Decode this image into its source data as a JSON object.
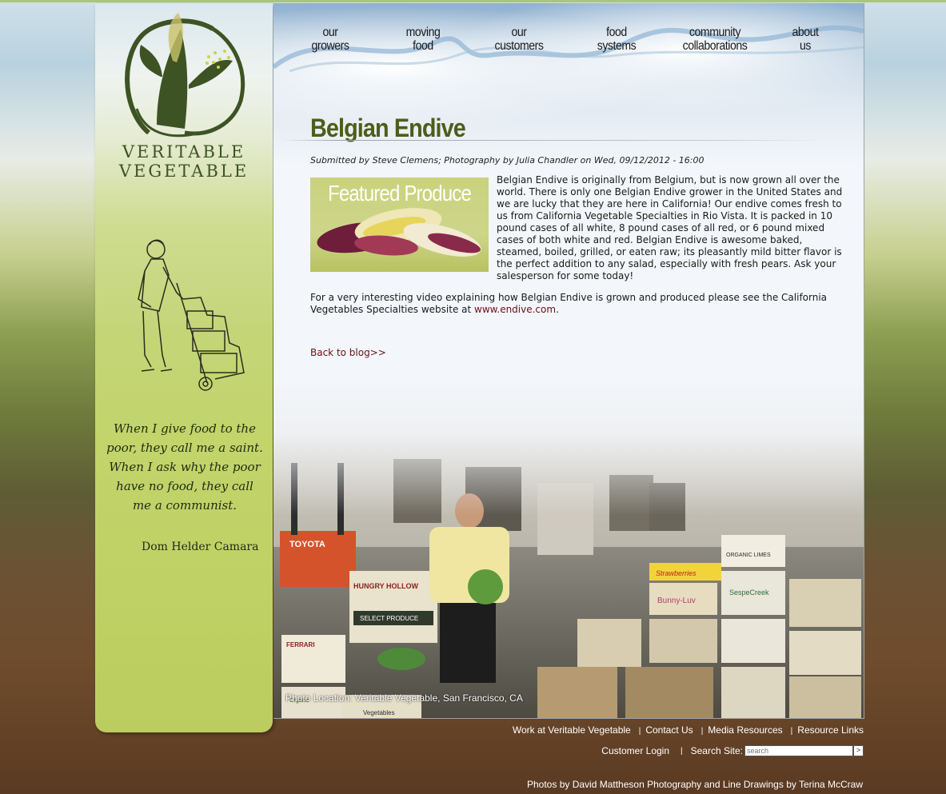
{
  "nav": [
    {
      "label": "our\ngrowers"
    },
    {
      "label": "moving\nfood"
    },
    {
      "label": "our\ncustomers"
    },
    {
      "label": "food\nsystems"
    },
    {
      "label": "community\ncollaborations"
    },
    {
      "label": "about\nus"
    }
  ],
  "sidebar": {
    "logo_line1": "VERITABLE",
    "logo_line2": "VEGETABLE",
    "quote": "When I give food to the poor, they call me a saint. When I ask why the poor have no food, they call me a communist.",
    "quote_author": "Dom Helder Camara"
  },
  "article": {
    "title": "Belgian Endive",
    "byline": "Submitted by Steve Clemens; Photography by Julia Chandler on Wed, 09/12/2012 - 16:00",
    "featured_label": "Featured Produce",
    "paragraph1": "Belgian Endive is originally from Belgium, but is now grown all over the world.  There is only one Belgian Endive grower in the United States and we are lucky that they are here in California! Our endive comes fresh to us from California Vegetable Specialties in Rio Vista. It is packed in 10 pound cases of all white, 8 pound cases of all red, or 6 pound mixed cases of both white and red.  Belgian Endive is awesome baked, steamed, boiled, grilled, or eaten raw; its pleasantly mild bitter flavor is the perfect addition to any salad, especially with fresh pears.  Ask your salesperson for some today!",
    "paragraph2_text": "For a very interesting video explaining how Belgian Endive is grown and produced please see the California Vegetables Specialties website at ",
    "paragraph2_link": "www.endive.com",
    "paragraph2_end": ".",
    "back_link": "Back to blog>>"
  },
  "photo": {
    "caption": "Photo Location: Veritable Vegetable, San Francisco, CA",
    "signs": [
      "TOYOTA",
      "HUNGRY HOLLOW",
      "SELECT PRODUCE",
      "FERRARI",
      "Strawberries",
      "Bunny-Luv",
      "SespeCreek",
      "ORGANIC LIMES",
      "Organic",
      "Vegetables"
    ]
  },
  "footer": {
    "links": [
      "Work at Veritable Vegetable",
      "Contact Us",
      "Media Resources",
      "Resource Links"
    ],
    "customer_login": "Customer Login",
    "search_label": "Search Site:",
    "search_placeholder": "search",
    "search_button": ">",
    "credits": "Photos by David Mattheson Photography and Line Drawings by Terina McCraw"
  }
}
